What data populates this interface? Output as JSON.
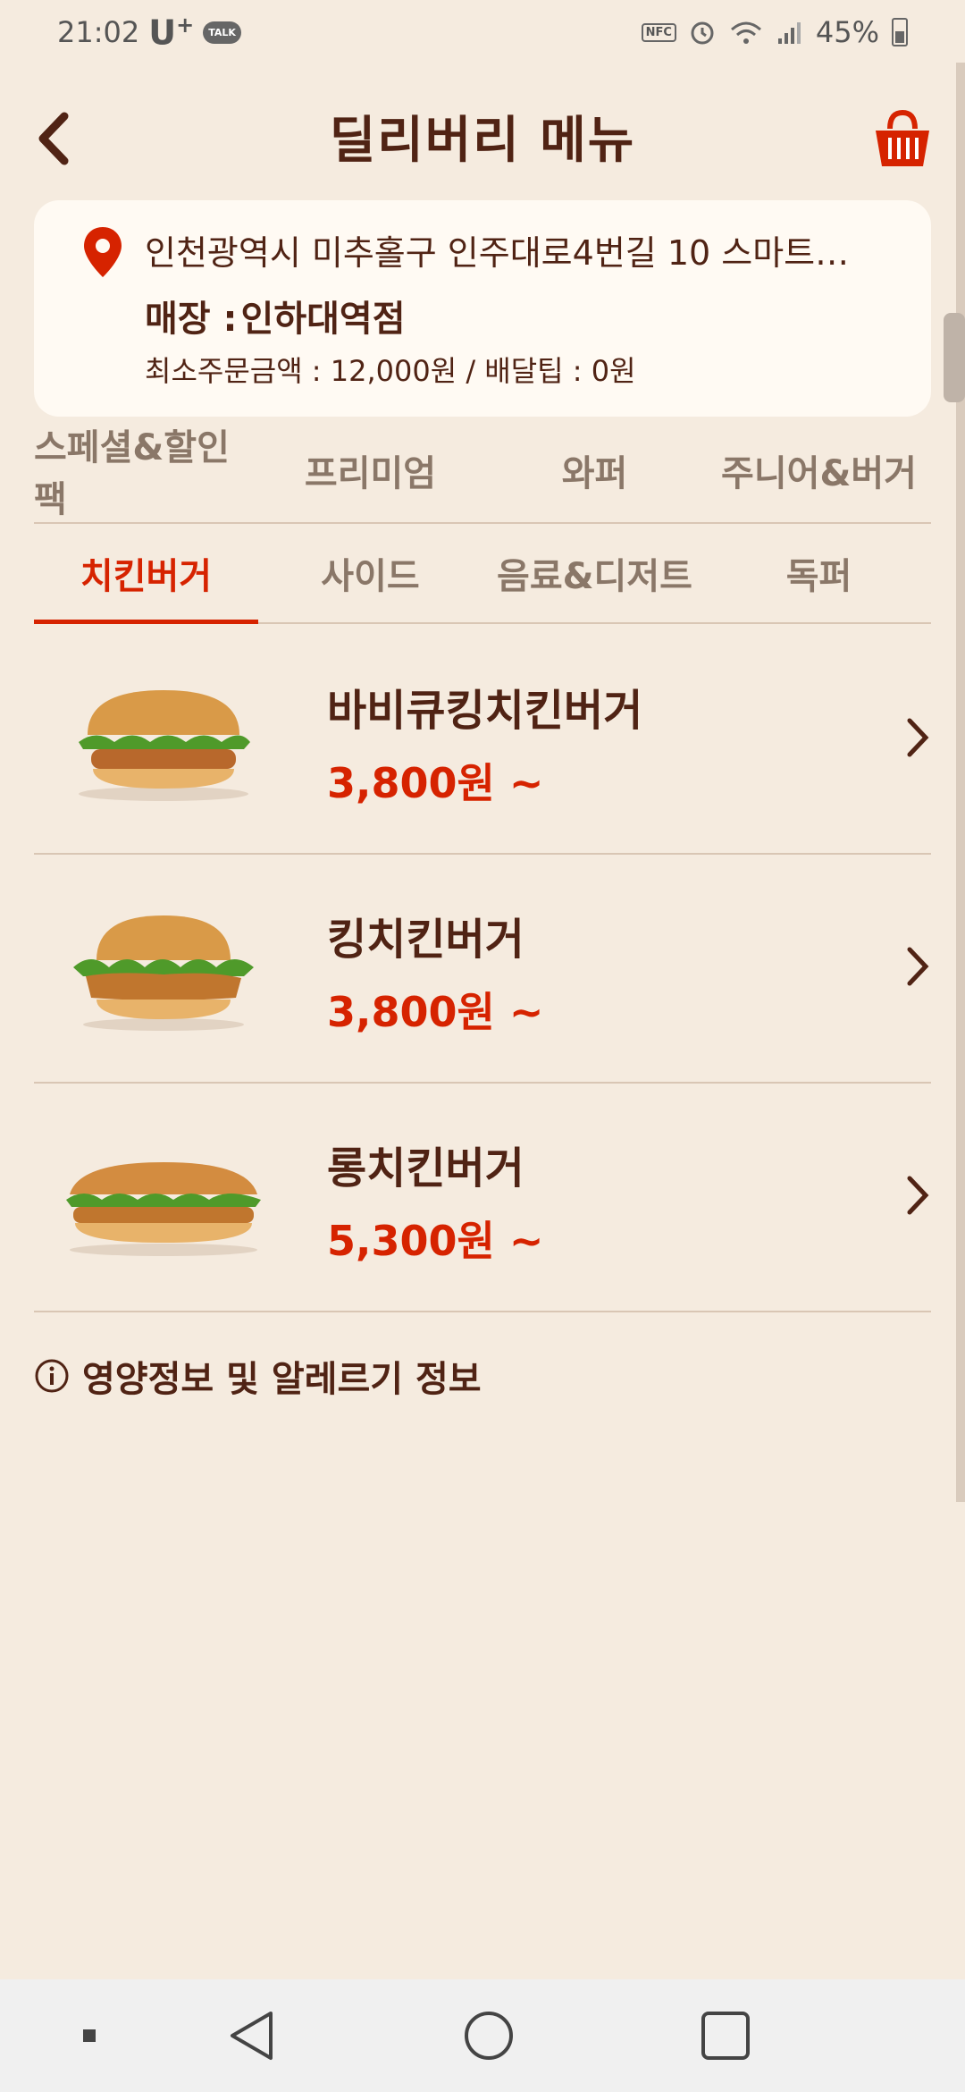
{
  "status_bar": {
    "time": "21:02",
    "carrier": "U",
    "carrier_plus": "+",
    "talk_badge": "TALK",
    "nfc_label": "NFC",
    "battery": "45%",
    "icons": [
      "nfc-icon",
      "alarm-icon",
      "wifi-icon",
      "signal-icon",
      "battery-icon"
    ]
  },
  "header": {
    "title": "딜리버리 메뉴",
    "back_icon": "chevron-left-icon",
    "cart_icon": "basket-icon"
  },
  "address_card": {
    "address": "인천광역시 미추홀구 인주대로4번길 10 스마트…",
    "store_label": "매장 :",
    "store_name": "인하대역점",
    "min_order": "최소주문금액 : 12,000원 / 배달팁 : 0원"
  },
  "categories": {
    "row1": [
      "스페셜&할인팩",
      "프리미엄",
      "와퍼",
      "주니어&버거"
    ],
    "row2": [
      "치킨버거",
      "사이드",
      "음료&디저트",
      "독퍼"
    ],
    "active": "치킨버거"
  },
  "menu_items": [
    {
      "name": "바비큐킹치킨버거",
      "price": "3,800원 ~"
    },
    {
      "name": "킹치킨버거",
      "price": "3,800원 ~"
    },
    {
      "name": "롱치킨버거",
      "price": "5,300원 ~"
    }
  ],
  "nutrition_link": "영양정보 및 알레르기 정보",
  "colors": {
    "background": "#f5ebdf",
    "brand_brown": "#502314",
    "accent_red": "#d62300",
    "card": "#fffaf3"
  }
}
